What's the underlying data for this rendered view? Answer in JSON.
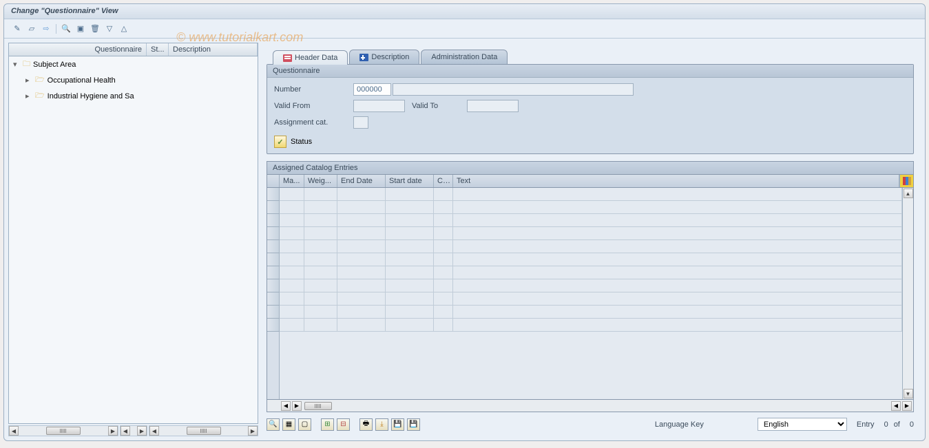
{
  "title": "Change \"Questionnaire\" View",
  "watermark": "© www.tutorialkart.com",
  "tree": {
    "headers": {
      "col1": "Questionnaire",
      "col2": "St...",
      "col3": "Description"
    },
    "root_label": "Subject Area",
    "items": [
      {
        "label": "Occupational Health"
      },
      {
        "label": "Industrial Hygiene and Sa"
      }
    ]
  },
  "tabs": {
    "header_data": "Header Data",
    "description": "Description",
    "administration": "Administration Data"
  },
  "groupbox": {
    "title": "Questionnaire",
    "number_label": "Number",
    "number_value": "000000",
    "number_desc": "",
    "valid_from_label": "Valid From",
    "valid_from_value": "",
    "valid_to_label": "Valid To",
    "valid_to_value": "",
    "assignment_label": "Assignment cat.",
    "assignment_value": "",
    "status_label": "Status"
  },
  "catalog": {
    "title": "Assigned Catalog Entries",
    "cols": {
      "c1": "Ma...",
      "c2": "Weig...",
      "c3": "End Date",
      "c4": "Start date",
      "c5": "C...",
      "c6": "Text"
    }
  },
  "footer": {
    "language_label": "Language Key",
    "language_value": "English",
    "entry_label": "Entry",
    "entry_current": "0",
    "entry_of": "of",
    "entry_total": "0"
  }
}
